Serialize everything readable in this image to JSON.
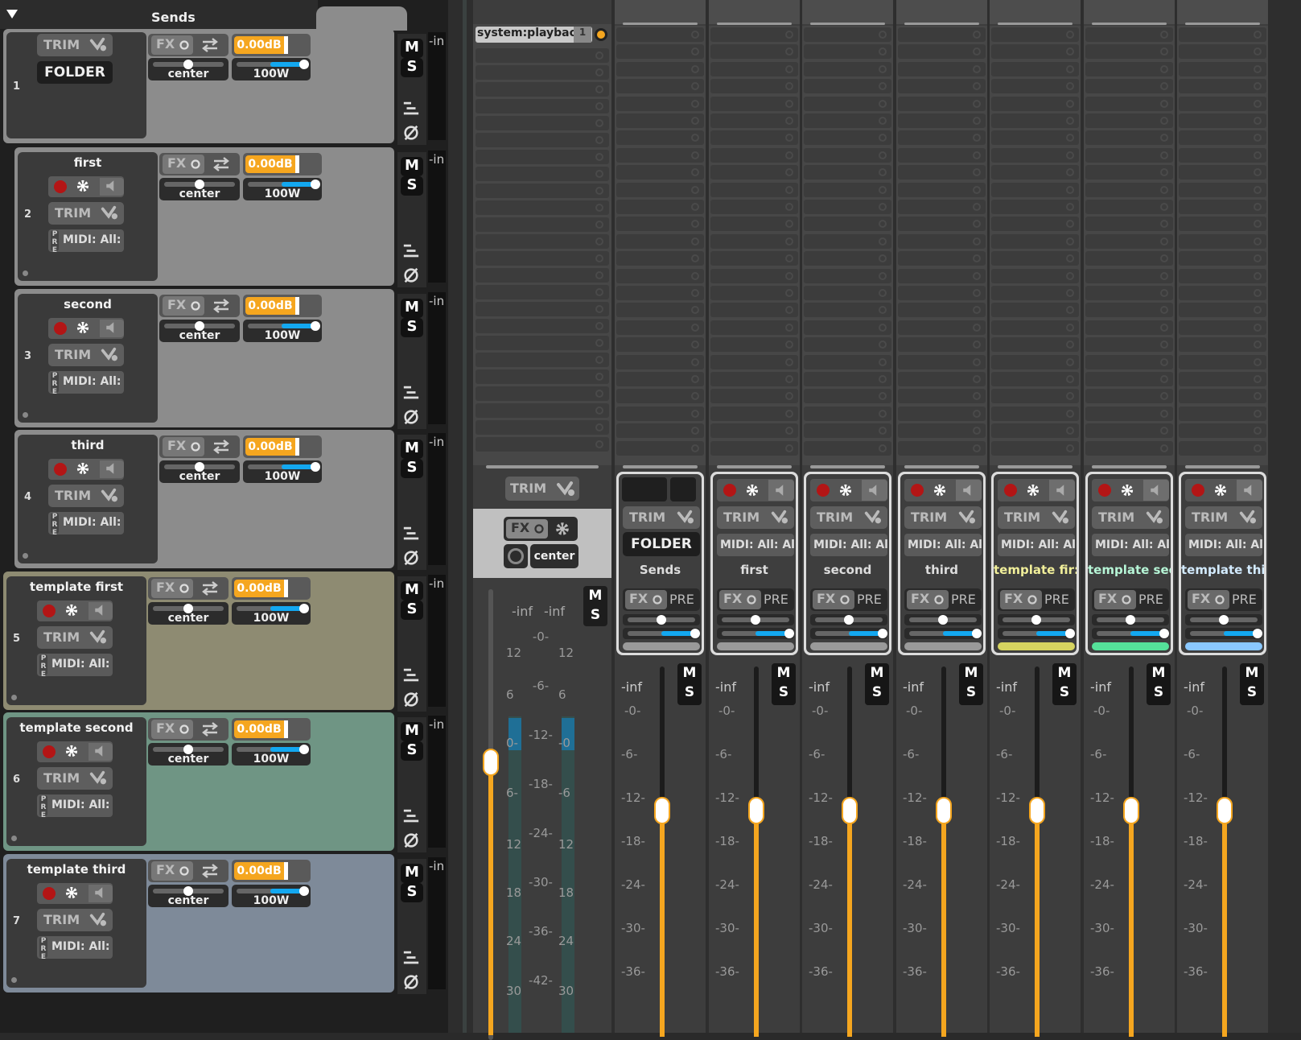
{
  "folder": {
    "title": "Sends"
  },
  "icons": {
    "triangle": "collapse-triangle-icon",
    "fx": "fx-icon",
    "route": "route-icon",
    "swap": "swap-icon",
    "gear": "gear-icon",
    "speaker": "speaker-icon",
    "phase": "phase-invert-icon",
    "automation": "automation-icon"
  },
  "tracks": [
    {
      "num": "1",
      "name": "",
      "trim": "TRIM",
      "folder_label": "FOLDER",
      "fx": "FX",
      "gain": "0.00dB",
      "pan": "center",
      "width": "100W",
      "m": "M",
      "s": "S",
      "inlabel": "-in",
      "color": "#8c8c8c"
    },
    {
      "num": "2",
      "name": "first",
      "trim": "TRIM",
      "midi": "MIDI: All:",
      "pre": "PRE",
      "fx": "FX",
      "gain": "0.00dB",
      "pan": "center",
      "width": "100W",
      "m": "M",
      "s": "S",
      "inlabel": "-in",
      "color": "#8c8c8c"
    },
    {
      "num": "3",
      "name": "second",
      "trim": "TRIM",
      "midi": "MIDI: All:",
      "pre": "PRE",
      "fx": "FX",
      "gain": "0.00dB",
      "pan": "center",
      "width": "100W",
      "m": "M",
      "s": "S",
      "inlabel": "-in",
      "color": "#8c8c8c"
    },
    {
      "num": "4",
      "name": "third",
      "trim": "TRIM",
      "midi": "MIDI: All:",
      "pre": "PRE",
      "fx": "FX",
      "gain": "0.00dB",
      "pan": "center",
      "width": "100W",
      "m": "M",
      "s": "S",
      "inlabel": "-in",
      "color": "#8c8c8c"
    },
    {
      "num": "5",
      "name": "template first",
      "trim": "TRIM",
      "midi": "MIDI: All:",
      "pre": "PRE",
      "fx": "FX",
      "gain": "0.00dB",
      "pan": "center",
      "width": "100W",
      "m": "M",
      "s": "S",
      "inlabel": "-in",
      "color": "#8e8b72"
    },
    {
      "num": "6",
      "name": "template second",
      "trim": "TRIM",
      "midi": "MIDI: All:",
      "pre": "PRE",
      "fx": "FX",
      "gain": "0.00dB",
      "pan": "center",
      "width": "100W",
      "m": "M",
      "s": "S",
      "inlabel": "-in",
      "color": "#6f9584"
    },
    {
      "num": "7",
      "name": "template third",
      "trim": "TRIM",
      "midi": "MIDI: All:",
      "pre": "PRE",
      "fx": "FX",
      "gain": "0.00dB",
      "pan": "center",
      "width": "100W",
      "m": "M",
      "s": "S",
      "inlabel": "-in",
      "color": "#7e8a99"
    }
  ],
  "master": {
    "output": "system:playback",
    "output_channel": "1",
    "trim": "TRIM",
    "fx": "FX",
    "pan": "center",
    "m": "M",
    "s": "S",
    "peak_left": "-inf",
    "peak_right": "-inf",
    "scale_center": [
      "-0-",
      "-6-",
      "-12-",
      "-18-",
      "-24-",
      "-30-",
      "-36-",
      "-42-"
    ],
    "scale_left": [
      "12",
      "6",
      "0-",
      "6-",
      "12",
      "18",
      "24",
      "30"
    ],
    "scale_right": [
      "12",
      "6",
      "-0",
      "-6",
      "12",
      "18",
      "24",
      "30"
    ]
  },
  "strips": [
    {
      "name": "Sends",
      "trim": "TRIM",
      "folder_label": "FOLDER",
      "fx": "FX",
      "pre": "PRE",
      "peak": "-inf",
      "m": "M",
      "s": "S",
      "color": "#9a9a9a",
      "is_folder": true
    },
    {
      "name": "first",
      "trim": "TRIM",
      "midi": "MIDI: All: Al",
      "fx": "FX",
      "pre": "PRE",
      "peak": "-inf",
      "m": "M",
      "s": "S",
      "color": "#9a9a9a"
    },
    {
      "name": "second",
      "trim": "TRIM",
      "midi": "MIDI: All: Al",
      "fx": "FX",
      "pre": "PRE",
      "peak": "-inf",
      "m": "M",
      "s": "S",
      "color": "#9a9a9a"
    },
    {
      "name": "third",
      "trim": "TRIM",
      "midi": "MIDI: All: Al",
      "fx": "FX",
      "pre": "PRE",
      "peak": "-inf",
      "m": "M",
      "s": "S",
      "color": "#9a9a9a"
    },
    {
      "name": "template fir:",
      "trim": "TRIM",
      "midi": "MIDI: All: Al",
      "fx": "FX",
      "pre": "PRE",
      "peak": "-inf",
      "m": "M",
      "s": "S",
      "color": "#d6d460",
      "name_color": "#f1ef9a"
    },
    {
      "name": "template sec",
      "trim": "TRIM",
      "midi": "MIDI: All: Al",
      "fx": "FX",
      "pre": "PRE",
      "peak": "-inf",
      "m": "M",
      "s": "S",
      "color": "#55e29a",
      "name_color": "#b6f5d6"
    },
    {
      "name": "template thi",
      "trim": "TRIM",
      "midi": "MIDI: All: Al",
      "fx": "FX",
      "pre": "PRE",
      "peak": "-inf",
      "m": "M",
      "s": "S",
      "color": "#8ac8ff",
      "name_color": "#d3ebff"
    }
  ],
  "strip_scale": [
    "-0-",
    "-6-",
    "-12-",
    "-18-",
    "-24-",
    "-30-",
    "-36-"
  ]
}
